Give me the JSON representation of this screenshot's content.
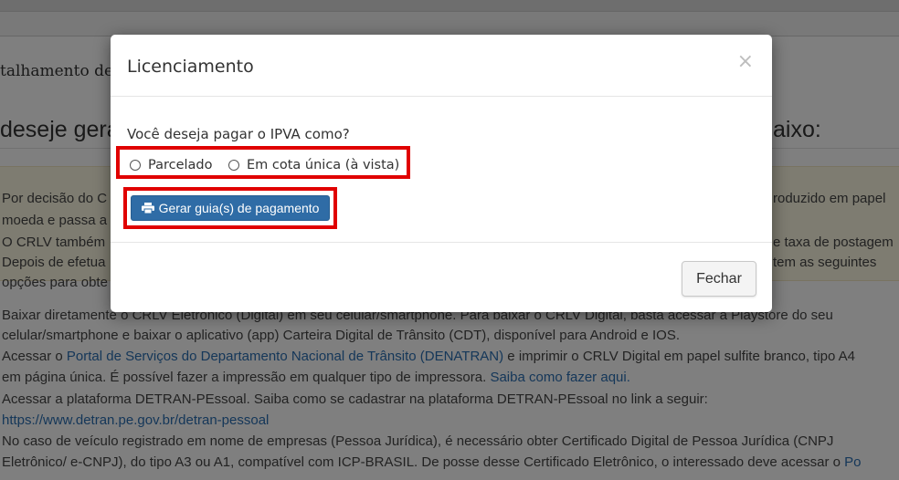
{
  "background": {
    "subtitle_left": "talhamento de",
    "heading_left": "deseje gera",
    "heading_right": "aixo:",
    "notice_lines": [
      {
        "left": "Por decisão do C",
        "right": "roduzido em papel"
      },
      {
        "left": "moeda e passa a",
        "right": ""
      },
      {
        "left": "O CRLV também",
        "right": "e taxa de postagem"
      },
      {
        "left": "Depois de efetua",
        "right": "tem as seguintes"
      },
      {
        "left": "opções para obte",
        "right": ""
      }
    ],
    "body": {
      "l1": "Baixar diretamente o CRLV Eletrônico (Digital) em seu celular/smartphone. Para baixar o CRLV Digital, basta acessar a Playstore do seu",
      "l2": "celular/smartphone e baixar o aplicativo (app) Carteira Digital de Trânsito (CDT), disponível para Android e IOS.",
      "l3_pre": "Acessar o ",
      "l3_link": "Portal de Serviços do Departamento Nacional de Trânsito (DENATRAN)",
      "l3_post": " e imprimir o CRLV Digital em papel sulfite branco, tipo A4",
      "l4_pre": "em página única. É possível fazer a impressão em qualquer tipo de impressora. ",
      "l4_link": "Saiba como fazer aqui.",
      "l5": "Acessar a plataforma DETRAN-PEssoal. Saiba como se cadastrar na plataforma DETRAN-PEssoal no link a seguir:",
      "l6_link": "https://www.detran.pe.gov.br/detran-pessoal",
      "l7": "No caso de veículo registrado em nome de empresas (Pessoa Jurídica), é necessário obter Certificado Digital de Pessoa Jurídica (CNPJ",
      "l8_pre": "Eletrônico/ e-CNPJ), do tipo A3 ou A1, compatível com ICP-BRASIL. De posse desse Certificado Eletrônico, o interessado deve acessar o ",
      "l8_link": "Po"
    }
  },
  "modal": {
    "title": "Licenciamento",
    "close_symbol": "×",
    "question": "Você deseja pagar o IPVA como?",
    "options": [
      "Parcelado",
      "Em cota única (à vista)"
    ],
    "generate_button": "Gerar guia(s) de pagamento",
    "close_button": "Fechar"
  },
  "colors": {
    "highlight": "#e00000",
    "primary_button": "#2f6ca6",
    "link": "#2a6eb2"
  },
  "icons": {
    "print": "print-icon",
    "close": "close-icon"
  }
}
